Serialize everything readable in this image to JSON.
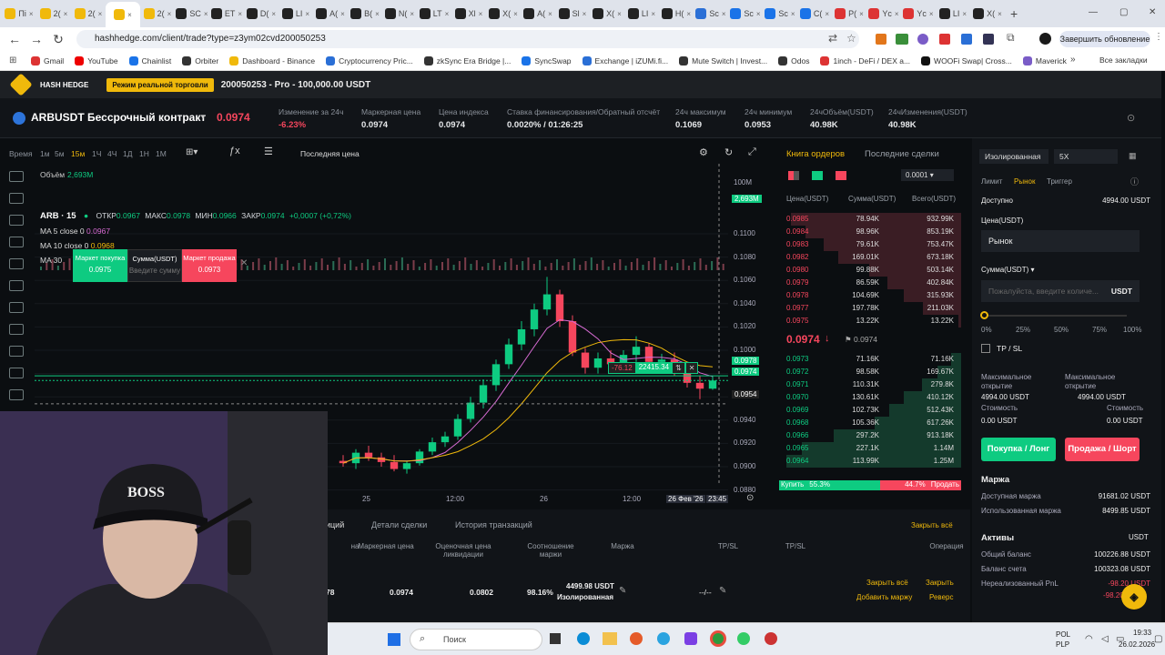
{
  "browser": {
    "tabs": [
      "Пі",
      "2(",
      "2(",
      "",
      "2(",
      "SC",
      "ЕТ",
      "D(",
      "LI",
      "A(",
      "B(",
      "N(",
      "LT",
      "Xl",
      "X(",
      "A(",
      "Sl",
      "X(",
      "LI",
      "H(",
      "Sc",
      "Sc",
      "Sc",
      "C(",
      "P(",
      "Yc",
      "Yc",
      "LI",
      "X("
    ],
    "url": "hashhedge.com/client/trade?type=z3ym02cvd200050253",
    "update_label": "Завершить обновление",
    "bookmarks": [
      "Gmail",
      "YouTube",
      "Chainlist",
      "Orbiter",
      "Dashboard - Binance",
      "Cryptocurrency Pric...",
      "zkSync Era Bridge |...",
      "SyncSwap",
      "Exchange | iZUMi.fi...",
      "Mute Switch | Invest...",
      "Odos",
      "1inch - DeFi / DEX a...",
      "WOOFi Swap| Cross...",
      "Maverick"
    ],
    "all_bookmarks": "Все закладки"
  },
  "app": {
    "brand": "HASH HEDGE",
    "mode": "Режим реальной торговли",
    "account": "200050253 - Pro - 100,000.00 USDT",
    "symbol": "ARBUSDT Бессрочный контракт",
    "price": "0.0974",
    "stats": [
      {
        "label": "Изменение за 24ч",
        "value": "-6.23%"
      },
      {
        "label": "Маркерная цена",
        "value": "0.0974"
      },
      {
        "label": "Цена индекса",
        "value": "0.0974"
      },
      {
        "label": "Ставка финансирования/Обратный отсчёт",
        "value": "0.0020% / 01:26:25"
      },
      {
        "label": "24ч максимум",
        "value": "0.1069"
      },
      {
        "label": "24ч минимум",
        "value": "0.0953"
      },
      {
        "label": "24чОбъём(USDT)",
        "value": "40.98K"
      },
      {
        "label": "24чИзменения(USDT)",
        "value": "40.98K"
      }
    ],
    "colors": {
      "green": "#0ecb81",
      "red": "#f6465d",
      "accent": "#f0b90b"
    }
  },
  "chart": {
    "timeframes": [
      "Время",
      "1м",
      "5м",
      "15м",
      "1Ч",
      "4Ч",
      "1Д",
      "1Н",
      "1М"
    ],
    "price_type": "Последняя цена",
    "volume_label": "Объём",
    "volume_value": "2,693M",
    "ohlc": {
      "title": "ARB · 15",
      "o_label": "ОТКР",
      "o": "0.0967",
      "h_label": "МАКС",
      "h": "0.0978",
      "l_label": "МИН",
      "l": "0.0966",
      "c_label": "ЗАКР",
      "c": "0.0974",
      "chg": "+0,0007 (+0,72%)"
    },
    "ma": [
      {
        "label": "MA 5 close 0",
        "value": "0.0967"
      },
      {
        "label": "MA 10 close 0",
        "value": "0.0968"
      },
      {
        "label": "MA 30",
        "value": ""
      }
    ],
    "quick": {
      "buy_label": "Маркет покупка",
      "buy_price": "0.0975",
      "amount_label": "Сумма(USDT)",
      "amount_placeholder": "Введите сумму",
      "sell_label": "Маркет продажа",
      "sell_price": "0.0973"
    },
    "axis": [
      "0.1100",
      "0.1080",
      "0.1060",
      "0.1040",
      "0.1020",
      "0.1000",
      "0.0980",
      "0.0960",
      "0.0940",
      "0.0920",
      "0.0900",
      "0.0880"
    ],
    "axis_top": "100M",
    "vol_tag": "2,693M",
    "tags": {
      "t1": "0.0978",
      "t2": "0.0974",
      "t3": "0.0954"
    },
    "position_line": {
      "pnl": "-76.12",
      "size": "22415.34"
    },
    "xlabels": [
      "25",
      "12:00",
      "26",
      "12:00"
    ],
    "date_tag": "26 Фев '26",
    "time_tag": "23:45"
  },
  "chart_data": {
    "type": "candlestick",
    "xlabel": "",
    "ylabel": "",
    "ylim": [
      0.0876,
      0.1116
    ],
    "candles": [
      [
        0.0905,
        0.091,
        0.09,
        0.0903
      ],
      [
        0.0903,
        0.0915,
        0.0898,
        0.0912
      ],
      [
        0.0912,
        0.0918,
        0.0905,
        0.0908
      ],
      [
        0.0908,
        0.0912,
        0.09,
        0.0904
      ],
      [
        0.0904,
        0.091,
        0.0896,
        0.0898
      ],
      [
        0.0898,
        0.0905,
        0.0894,
        0.0903
      ],
      [
        0.0903,
        0.0915,
        0.0901,
        0.0913
      ],
      [
        0.0913,
        0.0925,
        0.091,
        0.0921
      ],
      [
        0.0921,
        0.093,
        0.0917,
        0.0926
      ],
      [
        0.0926,
        0.0945,
        0.0923,
        0.0941
      ],
      [
        0.0941,
        0.096,
        0.0938,
        0.0955
      ],
      [
        0.0955,
        0.0975,
        0.095,
        0.097
      ],
      [
        0.097,
        0.0992,
        0.0965,
        0.0988
      ],
      [
        0.0988,
        0.101,
        0.0984,
        0.1005
      ],
      [
        0.1005,
        0.1025,
        0.1,
        0.1018
      ],
      [
        0.1018,
        0.104,
        0.1012,
        0.1035
      ],
      [
        0.1035,
        0.1063,
        0.103,
        0.1048
      ],
      [
        0.1048,
        0.1052,
        0.102,
        0.1025
      ],
      [
        0.1025,
        0.103,
        0.0995,
        0.0998
      ],
      [
        0.0998,
        0.1002,
        0.098,
        0.0985
      ],
      [
        0.0985,
        0.0998,
        0.098,
        0.0993
      ],
      [
        0.0993,
        0.1,
        0.0984,
        0.0988
      ],
      [
        0.0988,
        0.1,
        0.0983,
        0.0996
      ],
      [
        0.0996,
        0.1012,
        0.099,
        0.1003
      ],
      [
        0.1003,
        0.1006,
        0.0986,
        0.099
      ],
      [
        0.099,
        0.0997,
        0.0982,
        0.0992
      ],
      [
        0.0992,
        0.0998,
        0.0978,
        0.0982
      ],
      [
        0.0982,
        0.099,
        0.0968,
        0.0972
      ],
      [
        0.0972,
        0.0978,
        0.0958,
        0.0967
      ],
      [
        0.0967,
        0.0978,
        0.0966,
        0.0974
      ]
    ]
  },
  "orderbook": {
    "tab1": "Книга ордеров",
    "tab2": "Последние сделки",
    "step": "0.0001",
    "headers": [
      "Цена(USDT)",
      "Сумма(USDT)",
      "Всего(USDT)"
    ],
    "asks": [
      [
        "0.0985",
        "78.94K",
        "932.99K"
      ],
      [
        "0.0984",
        "98.96K",
        "853.19K"
      ],
      [
        "0.0983",
        "79.61K",
        "753.47K"
      ],
      [
        "0.0982",
        "169.01K",
        "673.18K"
      ],
      [
        "0.0980",
        "99.88K",
        "503.14K"
      ],
      [
        "0.0979",
        "86.59K",
        "402.84K"
      ],
      [
        "0.0978",
        "104.69K",
        "315.93K"
      ],
      [
        "0.0977",
        "197.78K",
        "211.03K"
      ],
      [
        "0.0975",
        "13.22K",
        "13.22K"
      ]
    ],
    "last": "0.0974",
    "mark": "0.0974",
    "bids": [
      [
        "0.0973",
        "71.16K",
        "71.16K"
      ],
      [
        "0.0972",
        "98.58K",
        "169.67K"
      ],
      [
        "0.0971",
        "110.31K",
        "279.8K"
      ],
      [
        "0.0970",
        "130.61K",
        "410.12K"
      ],
      [
        "0.0969",
        "102.73K",
        "512.43K"
      ],
      [
        "0.0968",
        "105.36K",
        "617.26K"
      ],
      [
        "0.0966",
        "297.2K",
        "913.18K"
      ],
      [
        "0.0965",
        "227.1K",
        "1.14M"
      ],
      [
        "0.0964",
        "113.99K",
        "1.25M"
      ]
    ],
    "buy_label": "Купить",
    "buy_pct": "55.3%",
    "sell_pct": "44.7%",
    "sell_label": "Продать"
  },
  "trade": {
    "margin_mode": "Изолированная",
    "leverage": "5X",
    "tabs": [
      "Лимит",
      "Рынок",
      "Триггер"
    ],
    "available_label": "Доступно",
    "available": "4994.00 USDT",
    "price_label": "Цена(USDT)",
    "price_value": "Рынок",
    "amount_label": "Сумма(USDT)",
    "amount_placeholder": "Пожалуйста, введите количе...",
    "amount_unit": "USDT",
    "slider": [
      "0%",
      "25%",
      "50%",
      "75%",
      "100%"
    ],
    "tpsl": "TP / SL",
    "max_open_label": "Максимальное открытие",
    "max_open_long": "4994.00 USDT",
    "max_open_short": "4994.00 USDT",
    "cost_label": "Стоимость",
    "cost_long": "0.00 USDT",
    "cost_short": "0.00 USDT",
    "buy_btn": "Покупка / Лонг",
    "sell_btn": "Продажа / Шорт",
    "margin_title": "Маржа",
    "margin_rows": [
      [
        "Доступная маржа",
        "91681.02 USDT"
      ],
      [
        "Использованная маржа",
        "8499.85 USDT"
      ]
    ],
    "assets_title": "Активы",
    "assets_unit": "USDT",
    "asset_rows": [
      [
        "Общий баланс",
        "100226.88 USDT"
      ],
      [
        "Баланс счета",
        "100323.08 USDT"
      ],
      [
        "Нереализованный PnL",
        "-98.20 USDT"
      ]
    ],
    "pnl_partial": "-98.20"
  },
  "positions": {
    "tabs": [
      "иций",
      "Детали сделки",
      "История транзакций"
    ],
    "close_all": "Закрыть всё",
    "headers": [
      "на",
      "Маркерная цена",
      "Оценочная цена ликвидации",
      "Соотношение маржи",
      "Маржа",
      "TP/SL",
      "TP/SL",
      "Операция"
    ],
    "row": {
      "entry": "78",
      "mark": "0.0974",
      "liq": "0.0802",
      "ratio": "98.16%",
      "margin": "4499.98 USDT",
      "margin_mode": "Изолированная",
      "tpsl": "--/--"
    },
    "ops": [
      "Закрыть всё",
      "Закрыть",
      "Добавить маржу",
      "Реверс"
    ]
  },
  "taskbar": {
    "search": "Поиск",
    "lang1": "POL",
    "lang2": "PLP",
    "time": "19:33",
    "date": "26.02.2026"
  }
}
